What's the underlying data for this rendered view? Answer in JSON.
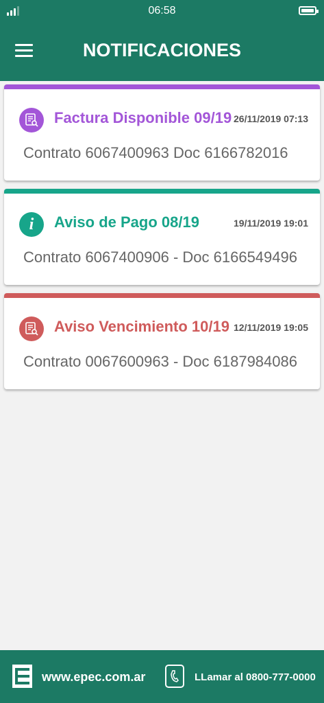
{
  "status_bar": {
    "time": "06:58"
  },
  "header": {
    "title": "NOTIFICACIONES"
  },
  "notifications": [
    {
      "title": "Factura Disponible 09/19",
      "date": "26/11/2019 07:13",
      "body": "Contrato 6067400963 Doc 6166782016",
      "color": "#a356d8",
      "icon": "invoice-search-icon"
    },
    {
      "title": "Aviso de Pago 08/19",
      "date": "19/11/2019 19:01",
      "body": "Contrato 6067400906 - Doc 6166549496",
      "color": "#17a58a",
      "icon": "info-icon"
    },
    {
      "title": "Aviso Vencimiento 10/19",
      "date": "12/11/2019 19:05",
      "body": "Contrato 0067600963 - Doc 6187984086",
      "color": "#cf5b5b",
      "icon": "invoice-search-icon"
    }
  ],
  "footer": {
    "website": "www.epec.com.ar",
    "call_label": "LLamar al 0800-777-0000"
  },
  "colors": {
    "primary": "#1c7a64",
    "background": "#f2f2f2"
  }
}
